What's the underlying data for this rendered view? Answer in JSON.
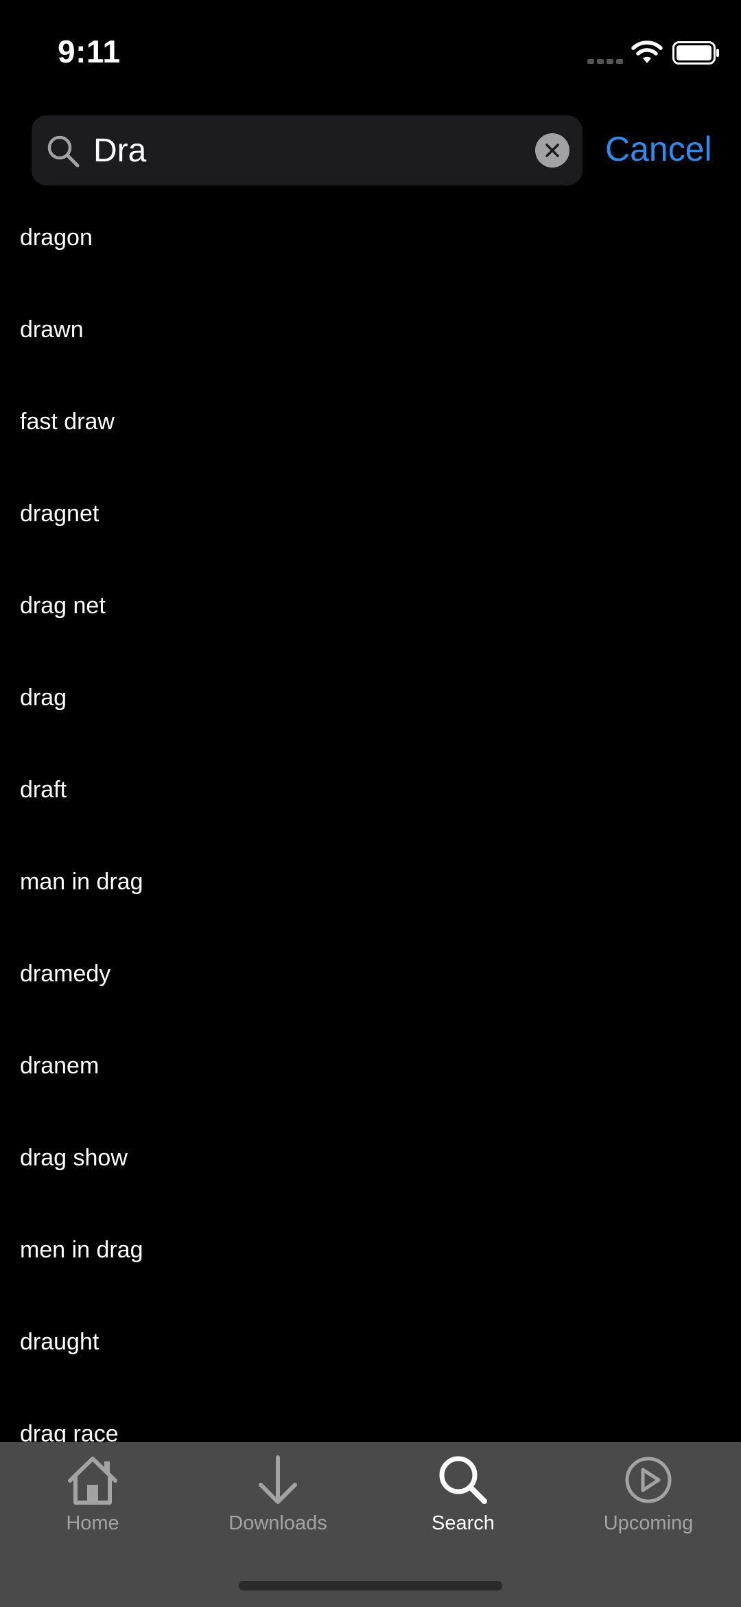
{
  "status_bar": {
    "time": "9:11"
  },
  "search": {
    "value": "Dra",
    "cancel_label": "Cancel"
  },
  "suggestions": [
    "dragon",
    "drawn",
    "fast draw",
    "dragnet",
    "drag net",
    "drag",
    "draft",
    "man in drag",
    "dramedy",
    "dranem",
    "drag show",
    "men in drag",
    "draught",
    "drag race"
  ],
  "tab_bar": {
    "tabs": [
      {
        "label": "Home",
        "icon": "home-icon",
        "active": false
      },
      {
        "label": "Downloads",
        "icon": "download-icon",
        "active": false
      },
      {
        "label": "Search",
        "icon": "search-icon",
        "active": true
      },
      {
        "label": "Upcoming",
        "icon": "play-circle-icon",
        "active": false
      }
    ]
  },
  "colors": {
    "background": "#000000",
    "accent": "#2d8cf0",
    "search_field": "#1c1c1e",
    "tab_bar": "#4a4a4a",
    "inactive_tab": "#a3a3a3"
  }
}
